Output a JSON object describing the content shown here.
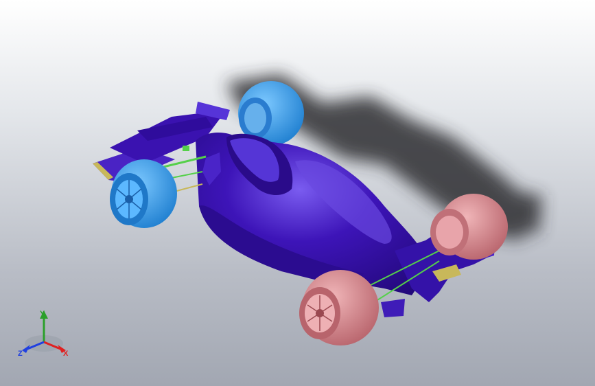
{
  "view": {
    "model_name": "formula-race-car",
    "background": {
      "top": "#ffffff",
      "bottom": "#a2a7b2"
    },
    "colors": {
      "body": "#3a11b0",
      "body_dark": "#240a7a",
      "body_light": "#6a48e0",
      "front_tire": "#3da8f0",
      "rear_tire": "#d98f95",
      "suspension": "#55d04a",
      "wing_endplate": "#c8b85a",
      "shadow": "#303036"
    }
  },
  "triad": {
    "x_label": "X",
    "y_label": "Y",
    "z_label": "Z",
    "x_color": "#e02020",
    "y_color": "#2aa02a",
    "z_color": "#2040e0"
  }
}
